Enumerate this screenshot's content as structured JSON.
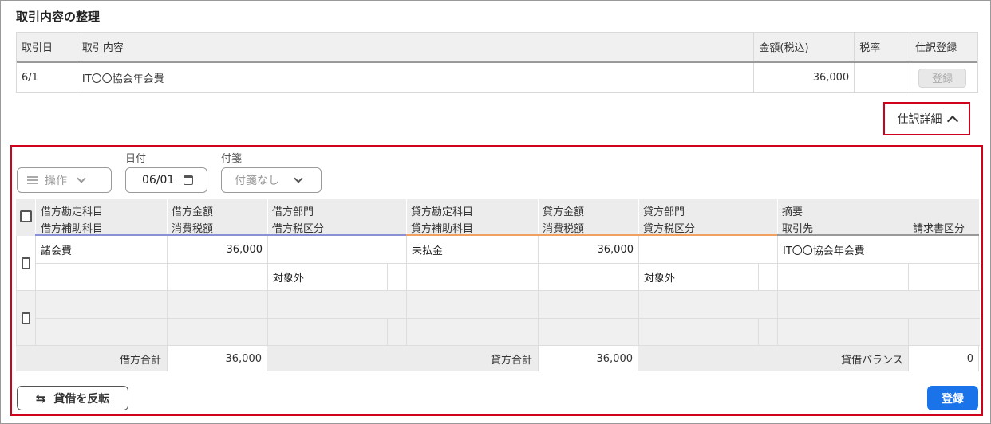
{
  "section_title": "取引内容の整理",
  "transactions": {
    "headers": [
      "取引日",
      "取引内容",
      "金額(税込)",
      "税率",
      "仕訳登録"
    ],
    "rows": [
      {
        "date": "6/1",
        "content": "IT〇〇協会年会費",
        "amount": "36,000",
        "tax_rate": "",
        "action": "登録"
      }
    ]
  },
  "detail_toggle": {
    "label": "仕訳詳細"
  },
  "toolbar": {
    "operation_label": "操作",
    "date_label": "日付",
    "date_value": "06/01",
    "tag_label": "付箋",
    "tag_value": "付箋なし"
  },
  "journal": {
    "headers": {
      "debit_account": "借方勘定科目",
      "debit_sub": "借方補助科目",
      "debit_amount": "借方金額",
      "debit_tax": "消費税額",
      "debit_dept": "借方部門",
      "debit_tax_cat": "借方税区分",
      "credit_account": "貸方勘定科目",
      "credit_sub": "貸方補助科目",
      "credit_amount": "貸方金額",
      "credit_tax": "消費税額",
      "credit_dept": "貸方部門",
      "credit_tax_cat": "貸方税区分",
      "memo": "摘要",
      "partner": "取引先",
      "invoice_cat": "請求書区分"
    },
    "entries": [
      {
        "debit_account": "諸会費",
        "debit_amount": "36,000",
        "debit_tax_cat": "対象外",
        "credit_account": "未払金",
        "credit_amount": "36,000",
        "credit_tax_cat": "対象外",
        "memo": "IT〇〇協会年会費"
      }
    ],
    "totals": {
      "debit_label": "借方合計",
      "debit_value": "36,000",
      "credit_label": "貸方合計",
      "credit_value": "36,000",
      "balance_label": "貸借バランス",
      "balance_value": "0"
    }
  },
  "buttons": {
    "swap": "貸借を反転",
    "register": "登録"
  },
  "colors": {
    "accent_red": "#d0021b",
    "primary_blue": "#1a73e8",
    "debit_line": "#8a8fd6",
    "credit_line": "#f0a060"
  }
}
